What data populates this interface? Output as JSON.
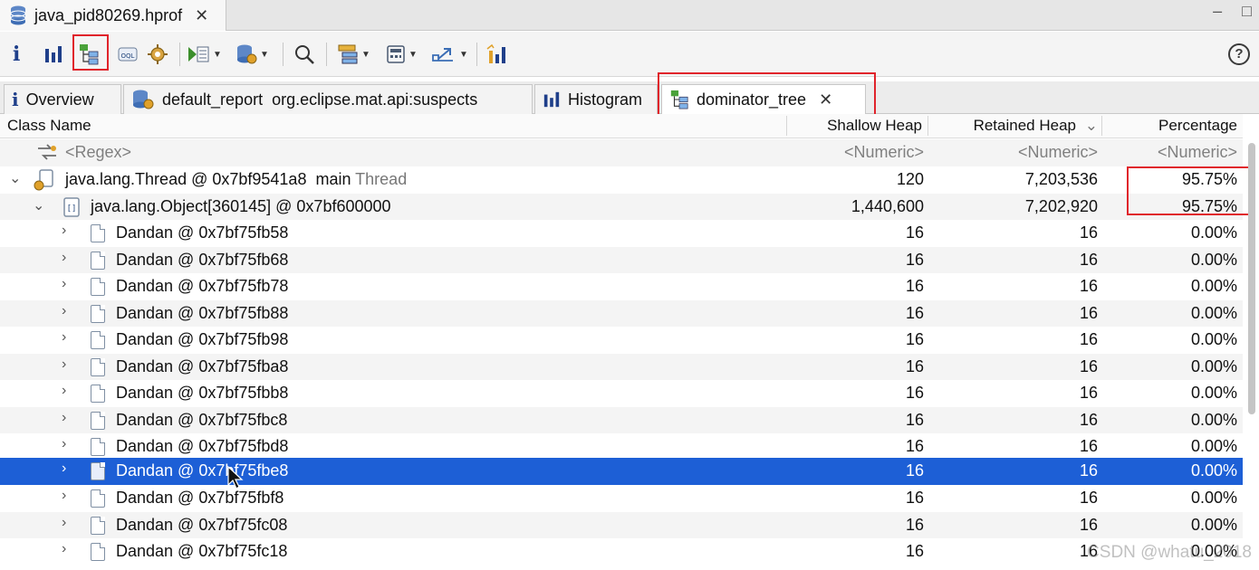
{
  "editor_tab": {
    "title": "java_pid80269.hprof",
    "close": "✕"
  },
  "window_controls": {
    "minimize": "‒",
    "maximize": "□"
  },
  "toolbar": {
    "items": [
      "overview-icon",
      "histogram-icon",
      "dominator-tree-icon",
      "oql-icon",
      "query-browser-icon",
      "run-report-icon",
      "heap-dump-overview-icon",
      "search-icon",
      "group-by-icon",
      "calculate-retained-icon",
      "export-icon",
      "compare-icon"
    ],
    "help": "?"
  },
  "query_tabs": [
    {
      "label": "Overview"
    },
    {
      "label": "default_report  org.eclipse.mat.api:suspects"
    },
    {
      "label": "Histogram"
    },
    {
      "label": "dominator_tree",
      "close": "✕",
      "active": true
    }
  ],
  "columns": {
    "class_name": "Class Name",
    "shallow_heap": "Shallow Heap",
    "retained_heap": "Retained Heap",
    "sort_indicator": "⌄",
    "percentage": "Percentage"
  },
  "filter_row": {
    "regex": "<Regex>",
    "shallow": "<Numeric>",
    "retained": "<Numeric>",
    "pct": "<Numeric>"
  },
  "rows": [
    {
      "name": "java.lang.Thread @ 0x7bf9541a8  main",
      "suffix": "Thread",
      "shallow": "120",
      "retained": "7,203,536",
      "pct": "95.75%"
    },
    {
      "name": "java.lang.Object[360145] @ 0x7bf600000",
      "shallow": "1,440,600",
      "retained": "7,202,920",
      "pct": "95.75%"
    },
    {
      "name": "Dandan @ 0x7bf75fb58",
      "shallow": "16",
      "retained": "16",
      "pct": "0.00%"
    },
    {
      "name": "Dandan @ 0x7bf75fb68",
      "shallow": "16",
      "retained": "16",
      "pct": "0.00%"
    },
    {
      "name": "Dandan @ 0x7bf75fb78",
      "shallow": "16",
      "retained": "16",
      "pct": "0.00%"
    },
    {
      "name": "Dandan @ 0x7bf75fb88",
      "shallow": "16",
      "retained": "16",
      "pct": "0.00%"
    },
    {
      "name": "Dandan @ 0x7bf75fb98",
      "shallow": "16",
      "retained": "16",
      "pct": "0.00%"
    },
    {
      "name": "Dandan @ 0x7bf75fba8",
      "shallow": "16",
      "retained": "16",
      "pct": "0.00%"
    },
    {
      "name": "Dandan @ 0x7bf75fbb8",
      "shallow": "16",
      "retained": "16",
      "pct": "0.00%"
    },
    {
      "name": "Dandan @ 0x7bf75fbc8",
      "shallow": "16",
      "retained": "16",
      "pct": "0.00%"
    },
    {
      "name": "Dandan @ 0x7bf75fbd8",
      "shallow": "16",
      "retained": "16",
      "pct": "0.00%"
    },
    {
      "name": "Dandan @ 0x7bf75fbe8",
      "shallow": "16",
      "retained": "16",
      "pct": "0.00%",
      "selected": true
    },
    {
      "name": "Dandan @ 0x7bf75fbf8",
      "shallow": "16",
      "retained": "16",
      "pct": "0.00%"
    },
    {
      "name": "Dandan @ 0x7bf75fc08",
      "shallow": "16",
      "retained": "16",
      "pct": "0.00%"
    },
    {
      "name": "Dandan @ 0x7bf75fc18",
      "shallow": "16",
      "retained": "16",
      "pct": "0.00%"
    }
  ],
  "watermark": "CSDN @whatu_2018",
  "colors": {
    "selection": "#1d5fd6",
    "highlight": "#e0242b"
  }
}
